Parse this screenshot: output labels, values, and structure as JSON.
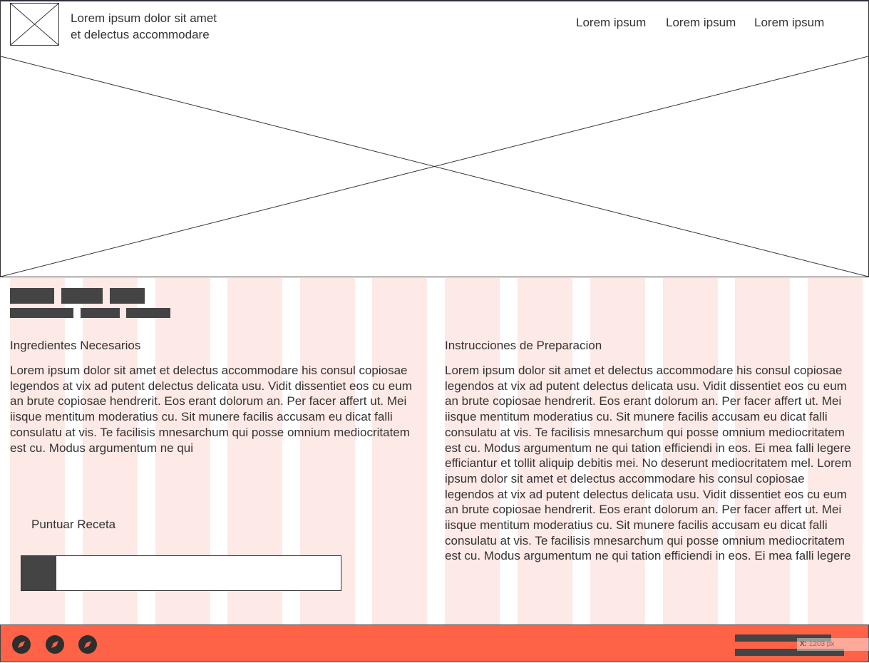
{
  "header": {
    "title_line1": "Lorem ipsum dolor sit amet",
    "title_line2": "et delectus accommodare",
    "nav": [
      "Lorem ipsum",
      "Lorem ipsum",
      "Lorem ipsum"
    ]
  },
  "sections": {
    "ingredients": {
      "title": "Ingredientes Necesarios",
      "text": "Lorem ipsum dolor sit amet et delectus accommodare his consul copiosae legendos at vix ad putent delectus delicata usu. Vidit dissentiet eos cu eum an brute copiosae hendrerit. Eos erant dolorum an. Per facer affert ut. Mei iisque mentitum moderatius cu. Sit munere facilis accusam eu dicat falli consulatu at vis. Te facilisis mnesarchum qui posse omnium mediocritatem est cu. Modus argumentum ne qui"
    },
    "instructions": {
      "title": "Instrucciones de Preparacion",
      "text": "Lorem ipsum dolor sit amet et delectus accommodare his consul copiosae legendos at vix ad putent delectus delicata usu. Vidit dissentiet eos cu eum an brute copiosae hendrerit. Eos erant dolorum an. Per facer affert ut. Mei iisque mentitum moderatius cu. Sit munere facilis accusam eu dicat falli consulatu at vis. Te facilisis mnesarchum qui posse omnium mediocritatem est cu. Modus argumentum ne qui tation efficiendi in eos. Ei mea falli legere efficiantur et tollit aliquip debitis mei. No deserunt mediocritatem mel. Lorem ipsum dolor sit amet et delectus accommodare his consul copiosae legendos at vix ad putent delectus delicata usu. Vidit dissentiet eos cu eum an brute copiosae hendrerit. Eos erant dolorum an. Per facer affert ut. Mei iisque mentitum moderatius cu. Sit munere facilis accusam eu dicat falli consulatu at vis. Te facilisis mnesarchum qui posse omnium mediocritatem est cu. Modus argumentum ne qui tation efficiendi in eos. Ei mea falli legere"
    }
  },
  "rating": {
    "label": "Puntuar Receta",
    "value_fraction": 0.11
  },
  "footer": {
    "icons": [
      "compass-icon",
      "compass-icon",
      "compass-icon"
    ],
    "coord_label": "X:",
    "coord_value": "1203 px"
  },
  "colors": {
    "footer": "#ff6347",
    "grid_column": "#fde9e6",
    "block": "#444444"
  }
}
